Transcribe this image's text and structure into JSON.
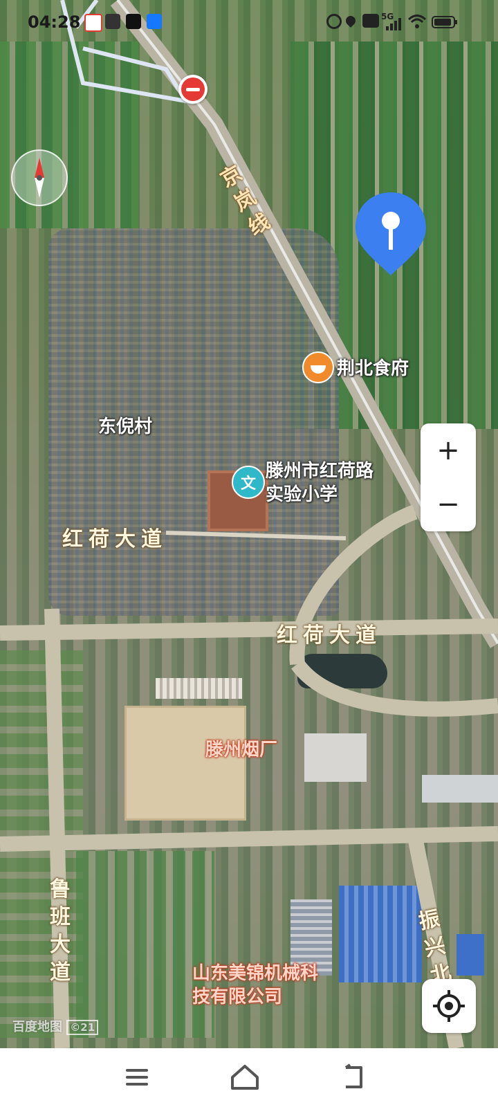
{
  "status_bar": {
    "time": "04:28",
    "network": "5G"
  },
  "map": {
    "labels": {
      "railway": "京岚线",
      "restaurant": "荆北食府",
      "village": "东倪村",
      "school": "滕州市红荷路实验小学",
      "road_west": "红荷大道",
      "road_east": "红荷大道",
      "factory": "滕州烟厂",
      "road_luban": "鲁班大道",
      "road_zhenxing": "振兴北",
      "company": "山东美锦机械科技有限公司"
    },
    "watermark": "百度地图",
    "watermark_year": "©21"
  },
  "controls": {
    "zoom_in": "+",
    "zoom_out": "−"
  },
  "colors": {
    "pin_blue": "#3b7ff0",
    "restaurant_orange": "#f08a2a",
    "school_teal": "#2fb9c8",
    "no_entry_red": "#e53935"
  },
  "icons": {
    "no_entry": "no-entry-icon",
    "compass": "compass-icon",
    "location_pin": "location-pin-icon",
    "restaurant": "restaurant-icon",
    "school": "school-icon",
    "locate": "locate-icon",
    "nav_menu": "menu-icon",
    "nav_home": "home-icon",
    "nav_back": "back-icon"
  }
}
